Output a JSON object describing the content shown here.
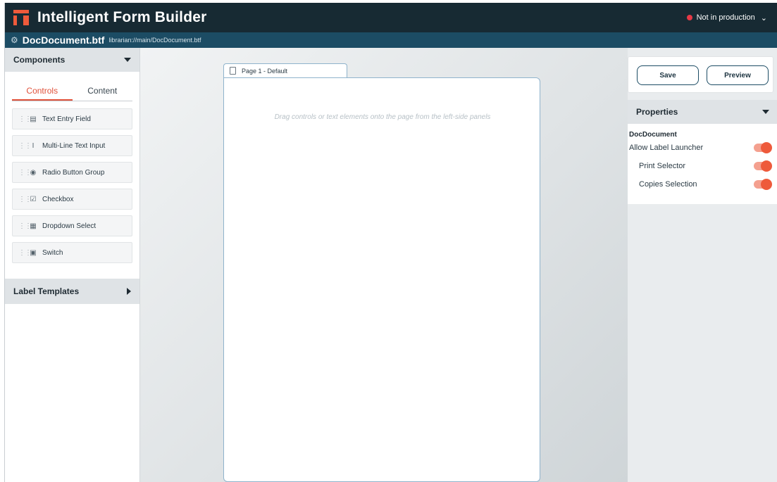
{
  "app": {
    "title": "Intelligent Form Builder",
    "environment": "Not in production",
    "environment_color": "#e63946",
    "accent_color": "#ee5a3b",
    "header_color": "#172a33",
    "docbar_color": "#1c4c64"
  },
  "document": {
    "name": "DocDocument.btf",
    "path": "librarian://main/DocDocument.btf"
  },
  "components": {
    "header": "Components",
    "tabs": [
      {
        "label": "Controls",
        "active": true
      },
      {
        "label": "Content",
        "active": false
      }
    ],
    "items": [
      {
        "label": "Text Entry Field",
        "icon": "text-field-icon"
      },
      {
        "label": "Multi-Line Text Input",
        "icon": "text-cursor-icon"
      },
      {
        "label": "Radio Button Group",
        "icon": "radio-icon"
      },
      {
        "label": "Checkbox",
        "icon": "checkbox-icon"
      },
      {
        "label": "Dropdown Select",
        "icon": "dropdown-icon"
      },
      {
        "label": "Switch",
        "icon": "switch-icon"
      }
    ]
  },
  "templates": {
    "header": "Label Templates"
  },
  "canvas": {
    "page_tab": "Page 1 - Default",
    "hint": "Drag controls or text elements onto the page from the left-side panels"
  },
  "actions": {
    "save": "Save",
    "preview": "Preview"
  },
  "properties": {
    "header": "Properties",
    "object": "DocDocument",
    "rows": [
      {
        "label": "Allow Label Launcher",
        "on": true
      },
      {
        "label": "Print Selector",
        "on": true
      },
      {
        "label": "Copies Selection",
        "on": true
      }
    ]
  }
}
